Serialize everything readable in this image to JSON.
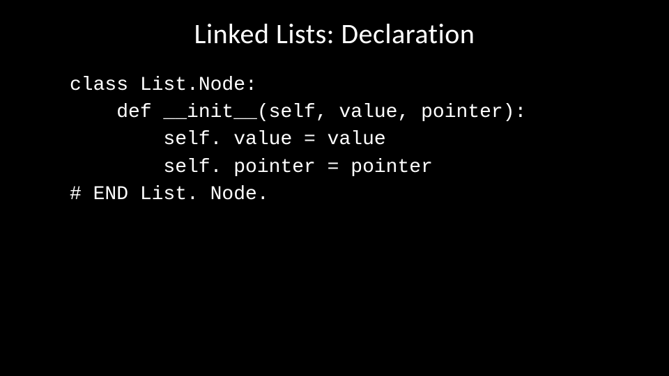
{
  "slide": {
    "title": "Linked Lists: Declaration",
    "code": {
      "line1": "class List.Node:",
      "line2": "    def __init__(self, value, pointer):",
      "line3": "        self. value = value",
      "line4": "        self. pointer = pointer",
      "line5": "# END List. Node."
    }
  }
}
